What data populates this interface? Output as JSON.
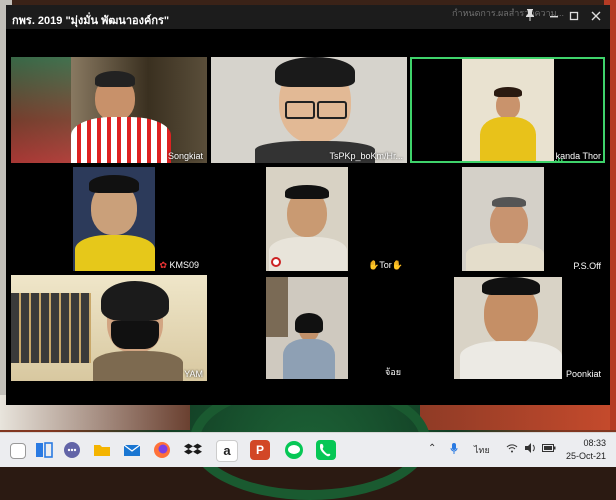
{
  "window": {
    "title": "กพร. 2019 \"มุ่งมั่น พัฒนาองค์กร\"",
    "bg_tab_1": "กำหนดการ...",
    "bg_tab_2": "ผลสำรวจความ..."
  },
  "participants": [
    {
      "name": "Songkiat"
    },
    {
      "name": "TsPKp_boKm/Hr..."
    },
    {
      "name": "kanda Thor",
      "active_speaker": true
    },
    {
      "name": "KMS09"
    },
    {
      "name": "Tor"
    },
    {
      "name": "P.S.Off"
    },
    {
      "name": "YAM"
    },
    {
      "name": "จ้อย"
    },
    {
      "name": "Poonkiat"
    }
  ],
  "taskbar": {
    "apps": [
      "task-view-icon",
      "snap-icon",
      "teams-chat-icon",
      "file-explorer-icon",
      "mail-icon",
      "firefox-icon",
      "dropbox-icon",
      "amazon-icon",
      "powerpoint-icon",
      "line-icon",
      "phone-icon"
    ],
    "language": "ไทย",
    "time": "08:33",
    "date": "25-Oct-21"
  },
  "colors": {
    "active_speaker": "#3fd36b",
    "window_bg": "#1c1c1c"
  }
}
